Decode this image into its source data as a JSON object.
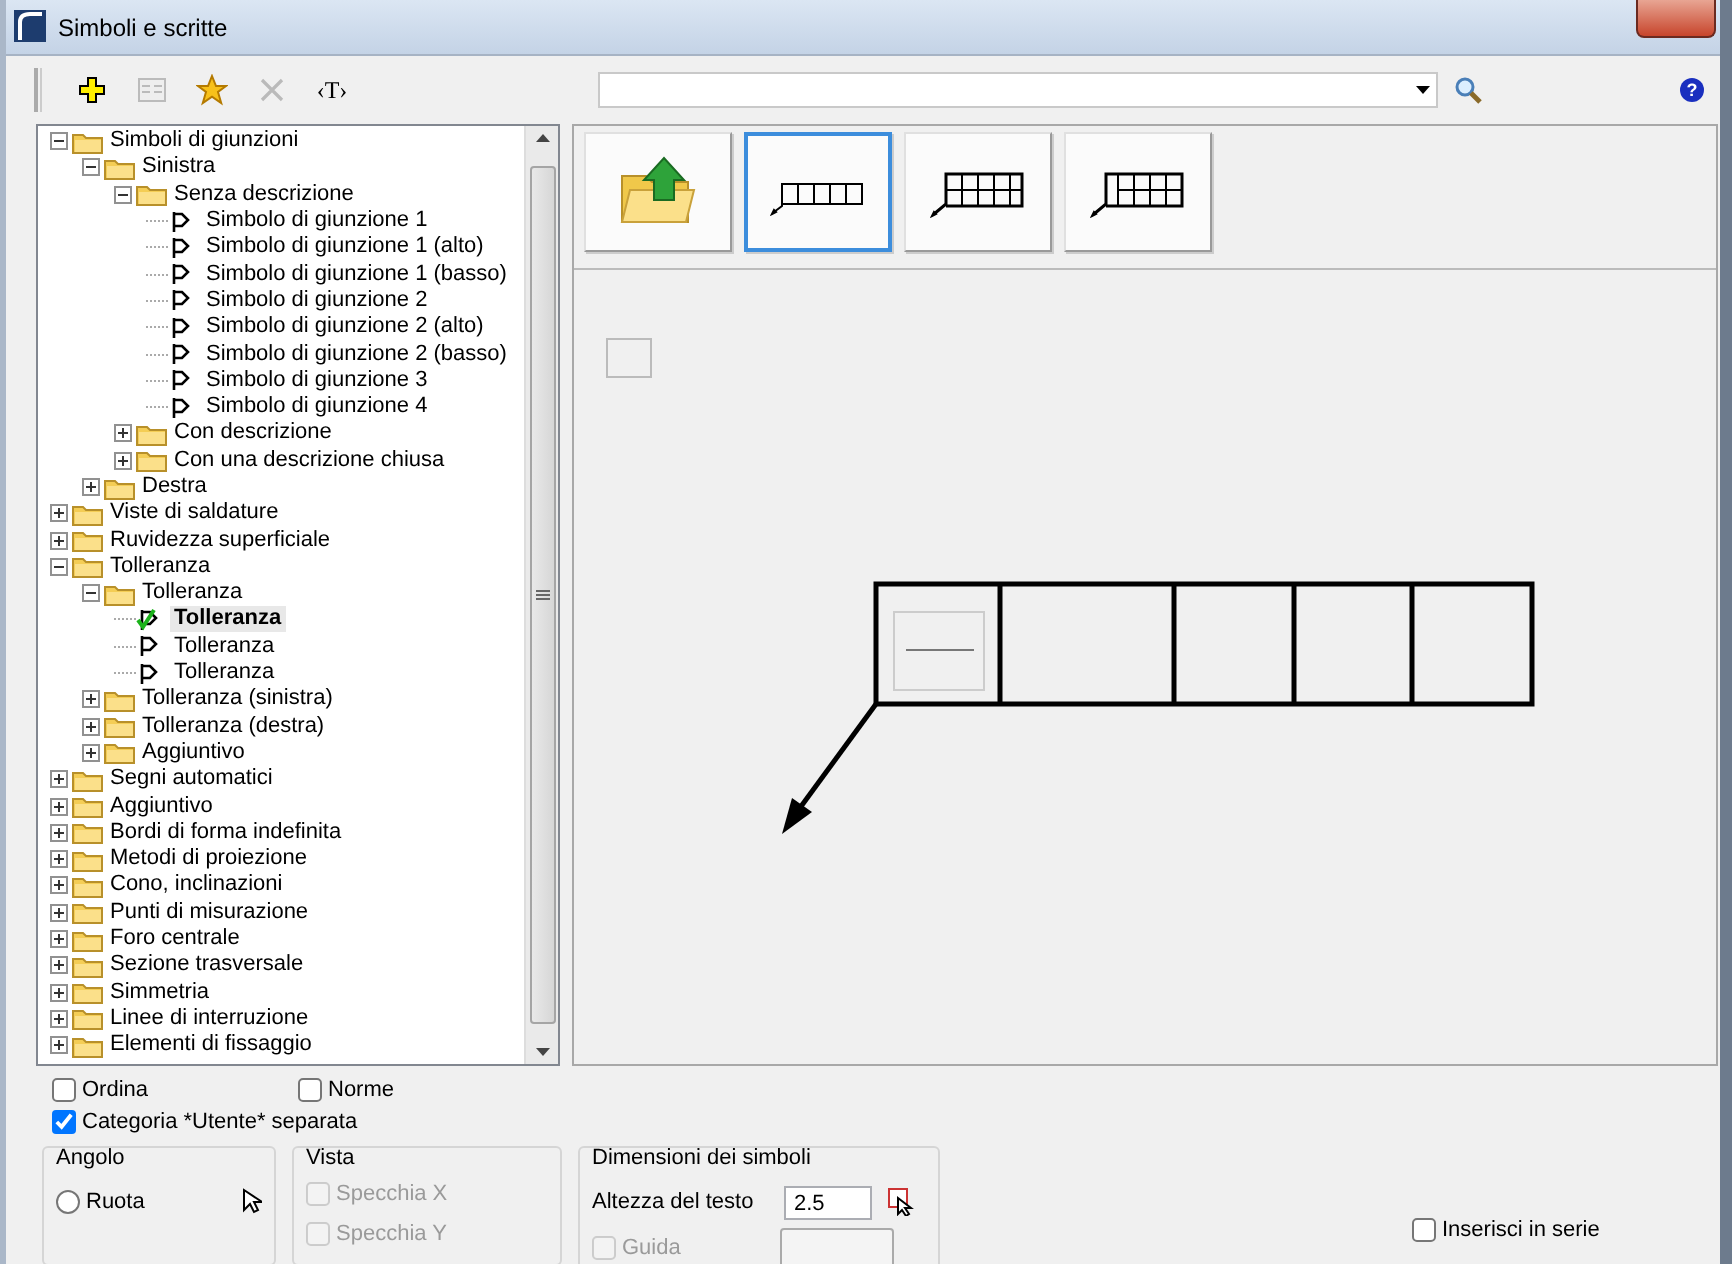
{
  "window": {
    "title": "Simboli e scritte"
  },
  "toolbar": [
    {
      "kind": "add",
      "disabled": false
    },
    {
      "kind": "properties",
      "disabled": true
    },
    {
      "kind": "favorite",
      "disabled": false
    },
    {
      "kind": "delete",
      "disabled": true
    },
    {
      "kind": "text",
      "label": "‹T›",
      "disabled": false
    }
  ],
  "help": {
    "label": "?"
  },
  "tree": [
    {
      "label": "Simboli di giunzioni",
      "kind": "folder",
      "expanded": true,
      "children": [
        {
          "label": "Sinistra",
          "kind": "folder",
          "expanded": true,
          "children": [
            {
              "label": "Senza descrizione",
              "kind": "folder",
              "expanded": true,
              "children": [
                {
                  "label": "Simbolo di giunzione 1",
                  "kind": "symbol",
                  "active": false,
                  "selected": false
                },
                {
                  "label": "Simbolo di giunzione 1 (alto)",
                  "kind": "symbol",
                  "active": false,
                  "selected": false
                },
                {
                  "label": "Simbolo di giunzione 1 (basso)",
                  "kind": "symbol",
                  "active": false,
                  "selected": false
                },
                {
                  "label": "Simbolo di giunzione 2",
                  "kind": "symbol",
                  "active": false,
                  "selected": false
                },
                {
                  "label": "Simbolo di giunzione 2 (alto)",
                  "kind": "symbol",
                  "active": false,
                  "selected": false
                },
                {
                  "label": "Simbolo di giunzione 2 (basso)",
                  "kind": "symbol",
                  "active": false,
                  "selected": false
                },
                {
                  "label": "Simbolo di giunzione 3",
                  "kind": "symbol",
                  "active": false,
                  "selected": false
                },
                {
                  "label": "Simbolo di giunzione 4",
                  "kind": "symbol",
                  "active": false,
                  "selected": false
                }
              ]
            },
            {
              "label": "Con descrizione",
              "kind": "folder",
              "expanded": false
            },
            {
              "label": "Con una descrizione chiusa",
              "kind": "folder",
              "expanded": false
            }
          ]
        },
        {
          "label": "Destra",
          "kind": "folder",
          "expanded": false
        }
      ]
    },
    {
      "label": "Viste di saldature",
      "kind": "folder",
      "expanded": false
    },
    {
      "label": "Ruvidezza superficiale",
      "kind": "folder",
      "expanded": false
    },
    {
      "label": "Tolleranza",
      "kind": "folder",
      "expanded": true,
      "children": [
        {
          "label": "Tolleranza",
          "kind": "folder",
          "expanded": true,
          "children": [
            {
              "label": "Tolleranza",
              "kind": "symbol",
              "active": true,
              "selected": true
            },
            {
              "label": "Tolleranza",
              "kind": "symbol",
              "active": false,
              "selected": false
            },
            {
              "label": "Tolleranza",
              "kind": "symbol",
              "active": false,
              "selected": false
            }
          ]
        },
        {
          "label": "Tolleranza (sinistra)",
          "kind": "folder",
          "expanded": false
        },
        {
          "label": "Tolleranza (destra)",
          "kind": "folder",
          "expanded": false
        },
        {
          "label": "Aggiuntivo",
          "kind": "folder",
          "expanded": false
        }
      ]
    },
    {
      "label": "Segni automatici",
      "kind": "folder",
      "expanded": false
    },
    {
      "label": "Aggiuntivo",
      "kind": "folder",
      "expanded": false
    },
    {
      "label": "Bordi di forma indefinita",
      "kind": "folder",
      "expanded": false
    },
    {
      "label": "Metodi di proiezione",
      "kind": "folder",
      "expanded": false
    },
    {
      "label": "Cono, inclinazioni",
      "kind": "folder",
      "expanded": false
    },
    {
      "label": "Punti di misurazione",
      "kind": "folder",
      "expanded": false
    },
    {
      "label": "Foro centrale",
      "kind": "folder",
      "expanded": false
    },
    {
      "label": "Sezione trasversale",
      "kind": "folder",
      "expanded": false
    },
    {
      "label": "Simmetria",
      "kind": "folder",
      "expanded": false
    },
    {
      "label": "Linee di interruzione",
      "kind": "folder",
      "expanded": false
    },
    {
      "label": "Elementi di fissaggio",
      "kind": "folder",
      "expanded": false
    }
  ],
  "symbol_tiles": [
    {
      "kind": "folder-up",
      "selected": false
    },
    {
      "kind": "single-row",
      "selected": true
    },
    {
      "kind": "double-row",
      "selected": false
    },
    {
      "kind": "double-row-tall",
      "selected": false
    }
  ],
  "options": [
    {
      "label": "Ordina",
      "checked": false
    },
    {
      "label": "Norme",
      "checked": false
    },
    {
      "label": "Categoria *Utente* separata",
      "checked": true
    }
  ],
  "angle_group": {
    "title": "Angolo",
    "options": [
      {
        "label": "Ruota",
        "selected": false
      }
    ]
  },
  "view_group": {
    "title": "Vista",
    "options": [
      {
        "label": "Specchia X",
        "checked": false,
        "disabled": true
      },
      {
        "label": "Specchia Y",
        "checked": false,
        "disabled": true
      }
    ]
  },
  "size_group": {
    "title": "Dimensioni dei simboli",
    "text_height": {
      "label": "Altezza del testo",
      "value": "2.5"
    },
    "guide": {
      "label": "Guida",
      "checked": false,
      "disabled": true
    }
  },
  "insert_series": {
    "label": "Inserisci in serie",
    "checked": false
  }
}
